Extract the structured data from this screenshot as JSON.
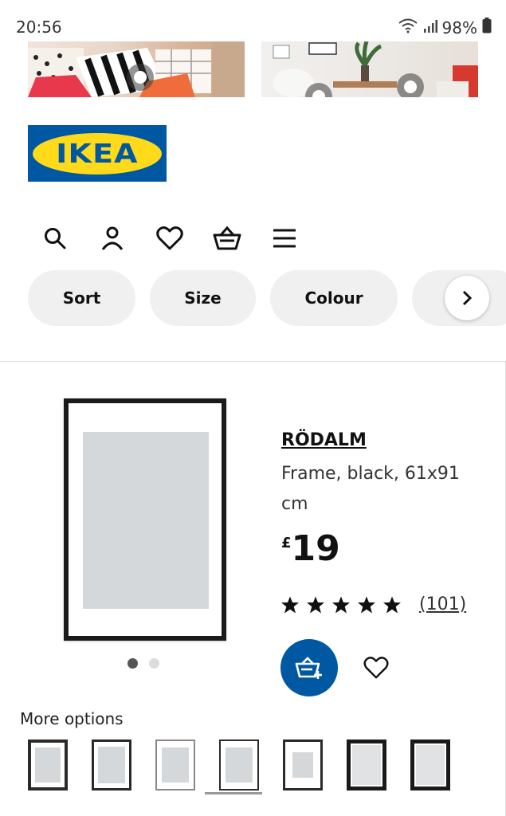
{
  "status_bar": {
    "time": "20:56",
    "battery": "98%"
  },
  "brand": {
    "logo_text": "IKEA",
    "blue": "#0058a3",
    "yellow": "#ffda1a"
  },
  "header_icons": [
    "search-icon",
    "account-icon",
    "heart-icon",
    "basket-icon",
    "menu-icon"
  ],
  "filters": [
    {
      "label": "Sort"
    },
    {
      "label": "Size"
    },
    {
      "label": "Colour"
    }
  ],
  "product": {
    "name": "RÖDALM",
    "description": "Frame, black, 61x91 cm",
    "price_currency": "£",
    "price_value": "19",
    "rating_stars": 5,
    "rating_count": "(101)",
    "image_page": 1,
    "image_pages": 2
  },
  "more_options": {
    "label": "More options",
    "thumbnails": [
      {
        "frame_color": "#2a2a2a"
      },
      {
        "frame_color": "#2a2a2a"
      },
      {
        "frame_color": "#888888"
      },
      {
        "frame_color": "#2a2a2a",
        "selected": true
      },
      {
        "frame_color": "#2a2a2a"
      },
      {
        "frame_color": "#1a1a1a"
      },
      {
        "frame_color": "#1a1a1a"
      }
    ]
  }
}
